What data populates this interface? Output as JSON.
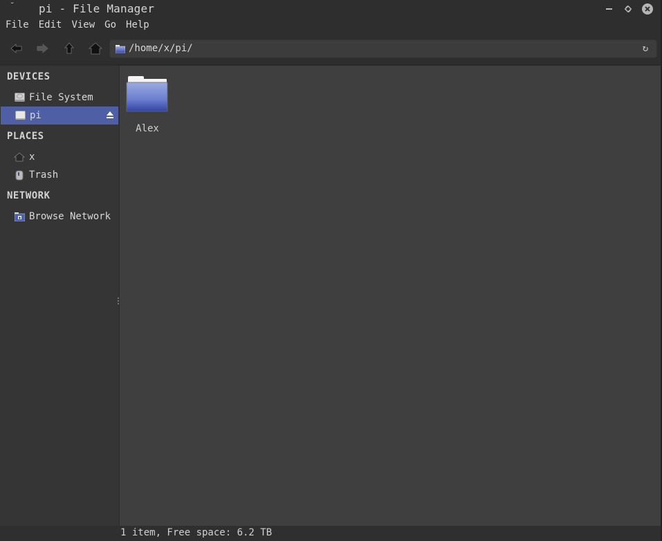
{
  "window": {
    "title": "pi - File Manager",
    "menu_glyph": "˘",
    "controls": {
      "minimize": "–",
      "maximize": "⤢",
      "close": "✕"
    }
  },
  "menubar": {
    "items": [
      {
        "label": "File"
      },
      {
        "label": "Edit"
      },
      {
        "label": "View"
      },
      {
        "label": "Go"
      },
      {
        "label": "Help"
      }
    ]
  },
  "toolbar": {
    "buttons": [
      {
        "name": "back",
        "icon": "arrow-left-icon"
      },
      {
        "name": "forward",
        "icon": "arrow-right-icon"
      },
      {
        "name": "up",
        "icon": "arrow-up-icon"
      },
      {
        "name": "home",
        "icon": "home-icon"
      }
    ],
    "location": {
      "path": "/home/x/pi/",
      "icon": "folder-icon",
      "reload_icon": "reload-icon",
      "reload_glyph": "↻"
    }
  },
  "sidebar": {
    "sections": [
      {
        "title": "DEVICES",
        "items": [
          {
            "label": "File System",
            "icon": "harddisk-icon",
            "selected": false
          },
          {
            "label": "pi",
            "icon": "drive-icon",
            "selected": true,
            "eject": true
          }
        ]
      },
      {
        "title": "PLACES",
        "items": [
          {
            "label": "x",
            "icon": "home-icon",
            "selected": false
          },
          {
            "label": "Trash",
            "icon": "trash-icon",
            "selected": false
          }
        ]
      },
      {
        "title": "NETWORK",
        "items": [
          {
            "label": "Browse Network",
            "icon": "network-folder-icon",
            "selected": false
          }
        ]
      }
    ]
  },
  "content": {
    "items": [
      {
        "name": "Alex",
        "type": "folder"
      }
    ]
  },
  "status": {
    "text": "1 item, Free space: 6.2 TB"
  },
  "colors": {
    "selection": "#4f5fa6",
    "folder_top": "#8e9fdc",
    "folder_bottom": "#3546a6",
    "content_bg": "#3f3f3f",
    "sidebar_bg": "#353535"
  }
}
